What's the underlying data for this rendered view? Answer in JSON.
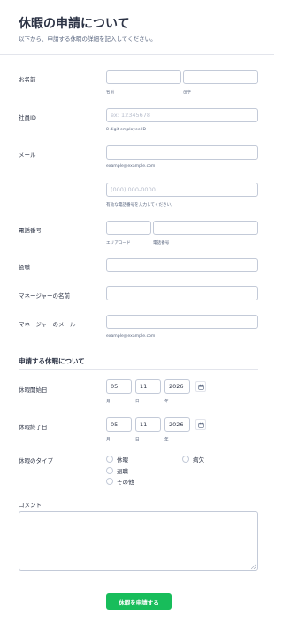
{
  "form": {
    "title": "休暇の申請について",
    "subtitle": "以下から、申請する休暇の詳細を記入してください。"
  },
  "fields": {
    "name": {
      "label": "お名前",
      "first_sublabel": "名前",
      "last_sublabel": "苗字"
    },
    "employee_id": {
      "label": "社員ID",
      "placeholder": "ex: 12345678",
      "sublabel": "8 digit employee ID"
    },
    "email": {
      "label": "メール",
      "sublabel": "example@example.com"
    },
    "phone_full": {
      "placeholder": "(000) 000-0000",
      "sublabel": "有効な電話番号を入力してください。"
    },
    "phone": {
      "label": "電話番号",
      "area_sublabel": "エリアコード",
      "number_sublabel": "電話番号"
    },
    "position": {
      "label": "役職"
    },
    "manager_name": {
      "label": "マネージャーの名前"
    },
    "manager_email": {
      "label": "マネージャーのメール",
      "sublabel": "example@example.com"
    }
  },
  "leave_section": {
    "title": "申請する休暇について",
    "start_date": {
      "label": "休暇開始日",
      "month": "05",
      "day": "11",
      "year": "2026",
      "month_sub": "月",
      "day_sub": "日",
      "year_sub": "年"
    },
    "end_date": {
      "label": "休暇終了日",
      "month": "05",
      "day": "11",
      "year": "2026",
      "month_sub": "月",
      "day_sub": "日",
      "year_sub": "年"
    },
    "leave_type": {
      "label": "休暇のタイプ",
      "options": [
        "休暇",
        "病欠",
        "退職",
        "その他"
      ]
    },
    "comment": {
      "label": "コメント"
    }
  },
  "submit_label": "休暇を申請する",
  "colors": {
    "accent": "#18bd5b",
    "text": "#2c3345",
    "border": "#c3cad8"
  }
}
